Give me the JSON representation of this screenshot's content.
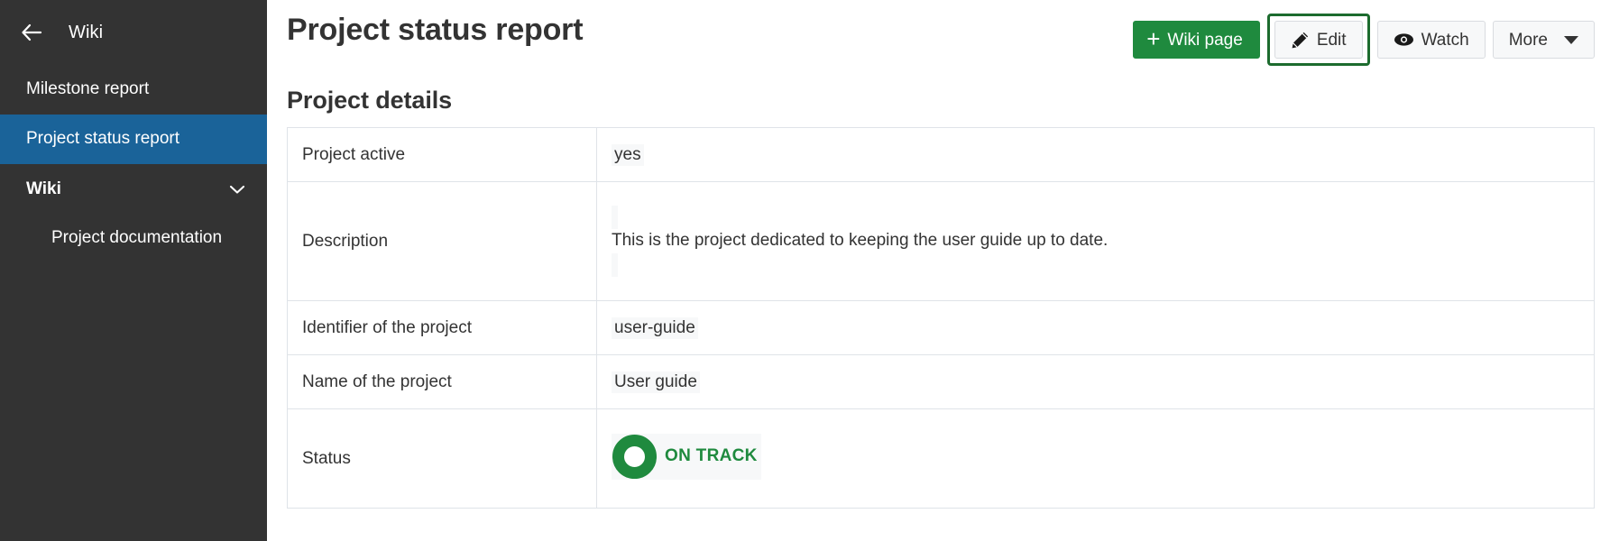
{
  "sidebar": {
    "back_icon": "arrow-left-icon",
    "title": "Wiki",
    "items": [
      {
        "label": "Milestone report",
        "active": false
      },
      {
        "label": "Project status report",
        "active": true
      }
    ],
    "group": {
      "label": "Wiki",
      "chevron_icon": "chevron-down-icon"
    },
    "sub_items": [
      {
        "label": "Project documentation"
      }
    ],
    "bg_color": "#333333",
    "active_color": "#1a6399"
  },
  "header": {
    "page_title": "Project status report"
  },
  "toolbar": {
    "wiki_page_label": "Wiki page",
    "wiki_page_icon": "plus-icon",
    "wiki_page_color": "#1f8a3e",
    "edit_label": "Edit",
    "edit_icon": "pencil-icon",
    "edit_focus_color": "#1c6b2e",
    "watch_label": "Watch",
    "watch_icon": "eye-icon",
    "more_label": "More",
    "more_icon": "caret-down-icon"
  },
  "main": {
    "section_heading": "Project details",
    "table": {
      "rows": [
        {
          "key": "Project active",
          "value": "yes",
          "type": "text"
        },
        {
          "key": "Description",
          "value": "This is the project dedicated to keeping the user guide up to date.",
          "type": "description"
        },
        {
          "key": "Identifier of the project",
          "value": "user-guide",
          "type": "text"
        },
        {
          "key": "Name of the project",
          "value": "User guide",
          "type": "text"
        },
        {
          "key": "Status",
          "value": "ON TRACK",
          "type": "status",
          "status_color": "#1f8a3e"
        }
      ]
    }
  }
}
